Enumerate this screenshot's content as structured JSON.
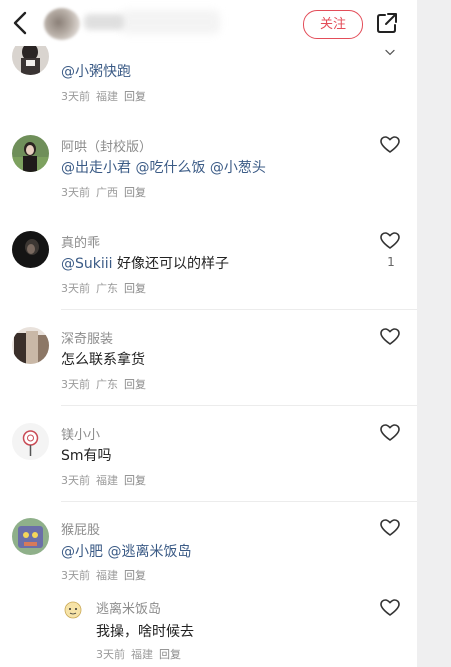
{
  "header": {
    "follow_label": "关注"
  },
  "comments": [
    {
      "body": "@小粥快跑",
      "time": "3天前",
      "location": "福建",
      "reply": "回复"
    },
    {
      "name": "阿哄（封校版）",
      "body": "@出走小君 @吃什么饭 @小葱头",
      "time": "3天前",
      "location": "广西",
      "reply": "回复"
    },
    {
      "name": "真的乖",
      "body_mention": "@Sukiii",
      "body_text": " 好像还可以的样子",
      "time": "3天前",
      "location": "广东",
      "reply": "回复",
      "likes": "1"
    },
    {
      "name": "深奇服装",
      "body": "怎么联系拿货",
      "time": "3天前",
      "location": "广东",
      "reply": "回复"
    },
    {
      "name": "镁小小",
      "body": "Sm有吗",
      "time": "3天前",
      "location": "福建",
      "reply": "回复"
    },
    {
      "name": "猴屁股",
      "body": "@小肥 @逃离米饭岛",
      "time": "3天前",
      "location": "福建",
      "reply": "回复",
      "subreply": {
        "name": "逃离米饭岛",
        "body": "我操，啥时候去",
        "time": "3天前",
        "location": "福建",
        "reply": "回复"
      }
    }
  ],
  "colors": {
    "accent": "#e34d59",
    "mention": "#3b5b86",
    "meta": "#9a9a9a"
  },
  "icons": [
    "back-icon",
    "share-icon",
    "heart-icon",
    "chevron-down-icon"
  ]
}
